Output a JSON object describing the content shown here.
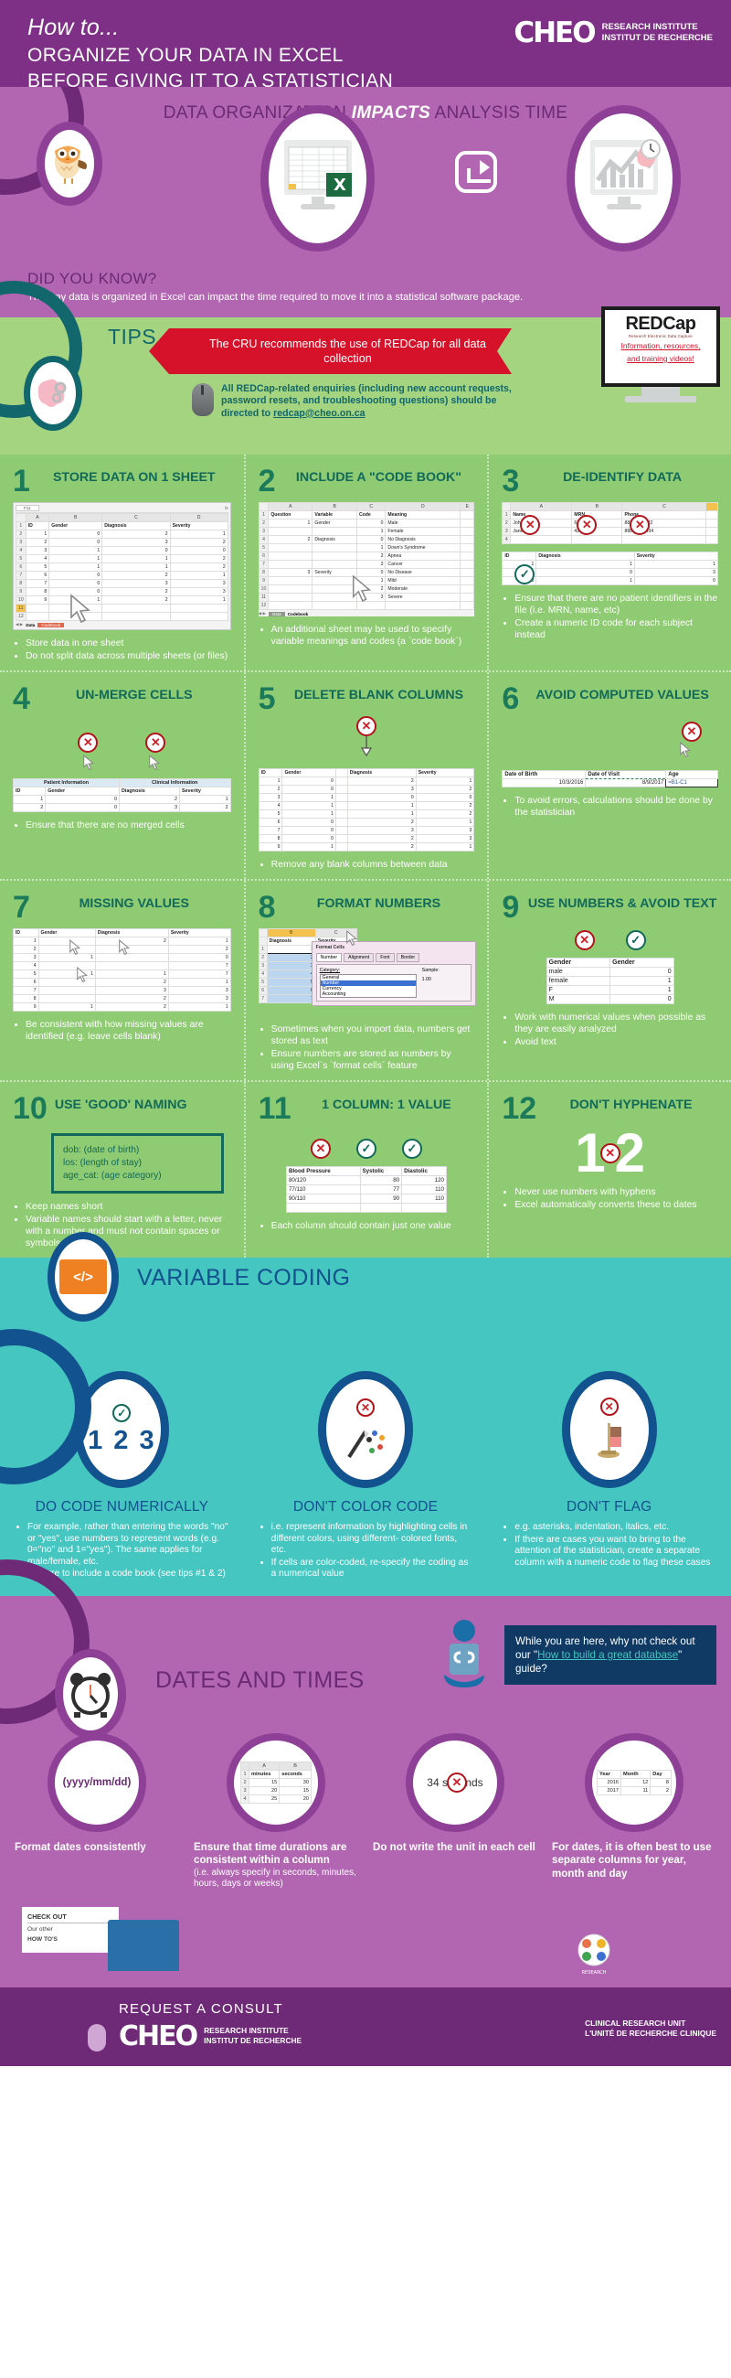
{
  "header": {
    "kicker": "How to...",
    "title_line1": "ORGANIZE YOUR DATA IN EXCEL",
    "title_line2": "BEFORE GIVING IT TO A STATISTICIAN",
    "brand": "CHEO",
    "brand_sub_en": "RESEARCH INSTITUTE",
    "brand_sub_fr": "INSTITUT DE RECHERCHE"
  },
  "impact": {
    "pre": "DATA ORGANIZATION",
    "em": "IMPACTS",
    "post": "ANALYSIS TIME"
  },
  "did_you_know": {
    "heading": "DID YOU KNOW?",
    "body": "The way data is organized in Excel can impact the time required to move it into a statistical software package."
  },
  "tips_banner": {
    "label": "TIPS",
    "ribbon": "The CRU recommends the use of REDCap for all data collection",
    "redcap_logo": "REDCap",
    "redcap_tagline": "Research Electronic Data Capture",
    "redcap_link_l1": "Information, resources,",
    "redcap_link_l2": "and training videos!",
    "note_text": "All REDCap-related enquiries (including new account requests, password resets, and troubleshooting questions) should be directed to ",
    "note_email": "redcap@cheo.on.ca"
  },
  "tips": [
    {
      "num": "1",
      "title": "STORE DATA ON 1 SHEET",
      "bullets": [
        "Store data in one sheet",
        "Do not split data across multiple sheets (or files)"
      ],
      "table": {
        "name_box": "F11",
        "col_letters": [
          "A",
          "B",
          "C",
          "D"
        ],
        "headers": [
          "ID",
          "Gender",
          "Diagnosis",
          "Severity"
        ],
        "rows": [
          [
            "1",
            "0",
            "2",
            "1"
          ],
          [
            "2",
            "0",
            "3",
            "2"
          ],
          [
            "3",
            "1",
            "0",
            "0"
          ],
          [
            "4",
            "1",
            "1",
            "2"
          ],
          [
            "5",
            "1",
            "1",
            "2"
          ],
          [
            "6",
            "0",
            "2",
            "1"
          ],
          [
            "7",
            "0",
            "3",
            "3"
          ],
          [
            "8",
            "0",
            "2",
            "3"
          ],
          [
            "9",
            "1",
            "2",
            "1"
          ]
        ],
        "sheet_tabs": [
          "Data",
          "Codebook"
        ]
      }
    },
    {
      "num": "2",
      "title": "INCLUDE A \"CODE BOOK\"",
      "bullets": [
        "An additional sheet may be used to specify variable meanings and codes (a `code book`)"
      ],
      "table": {
        "col_letters": [
          "A",
          "B",
          "C",
          "D",
          "E"
        ],
        "headers": [
          "Question",
          "Variable",
          "Code",
          "Meaning"
        ],
        "rows": [
          [
            "1",
            "Gender",
            "0",
            "Male"
          ],
          [
            "",
            "",
            "1",
            "Female"
          ],
          [
            "2",
            "Diagnosis",
            "0",
            "No Diagnosis"
          ],
          [
            "",
            "",
            "1",
            "Down's Syndrome"
          ],
          [
            "",
            "",
            "2",
            "Apnea"
          ],
          [
            "",
            "",
            "3",
            "Cancer"
          ],
          [
            "3",
            "Severity",
            "0",
            "No Disease"
          ],
          [
            "",
            "",
            "1",
            "Mild"
          ],
          [
            "",
            "",
            "2",
            "Moderate"
          ],
          [
            "",
            "",
            "3",
            "Severe"
          ]
        ],
        "sheet_tabs": [
          "Data",
          "Codebook"
        ]
      }
    },
    {
      "num": "3",
      "title": "DE-IDENTIFY DATA",
      "bullets": [
        "Ensure that there are no patient identifiers in the file (i.e. MRN, name, etc)",
        "Create a numeric ID code for each subject instead"
      ],
      "bad_table": {
        "col_letters": [
          "A",
          "B",
          "C"
        ],
        "headers": [
          "Name",
          "MRN",
          "Phone"
        ],
        "rows": [
          [
            "John Doe",
            "632542",
            "888-111-2222"
          ],
          [
            "Jane Doe",
            "424454",
            "888-333-1434"
          ]
        ]
      },
      "good_table": {
        "headers": [
          "ID",
          "Diagnosis",
          "Severity"
        ],
        "rows": [
          [
            "1",
            "1",
            "1"
          ],
          [
            "2",
            "0",
            "3"
          ],
          [
            "3",
            "1",
            "0"
          ]
        ]
      }
    },
    {
      "num": "4",
      "title": "UN-MERGE CELLS",
      "bullets": [
        "Ensure that there are no merged cells"
      ],
      "table": {
        "merged": [
          "Patient Information",
          "Clinical Information"
        ],
        "headers": [
          "ID",
          "Gender",
          "Diagnosis",
          "Severity"
        ],
        "rows": [
          [
            "1",
            "0",
            "2",
            "1"
          ],
          [
            "2",
            "0",
            "3",
            "2"
          ]
        ]
      }
    },
    {
      "num": "5",
      "title": "DELETE BLANK COLUMNS",
      "bullets": [
        "Remove any blank columns between data"
      ],
      "table": {
        "headers": [
          "ID",
          "Gender",
          "",
          "Diagnosis",
          "Severity"
        ],
        "rows": [
          [
            "1",
            "0",
            "",
            "2",
            "1"
          ],
          [
            "2",
            "0",
            "",
            "3",
            "2"
          ],
          [
            "3",
            "1",
            "",
            "0",
            "0"
          ],
          [
            "4",
            "1",
            "",
            "1",
            "2"
          ],
          [
            "5",
            "1",
            "",
            "1",
            "2"
          ],
          [
            "6",
            "0",
            "",
            "2",
            "1"
          ],
          [
            "7",
            "0",
            "",
            "3",
            "3"
          ],
          [
            "8",
            "0",
            "",
            "2",
            "3"
          ],
          [
            "9",
            "1",
            "",
            "2",
            "1"
          ]
        ]
      }
    },
    {
      "num": "6",
      "title": "AVOID COMPUTED VALUES",
      "bullets": [
        "To avoid errors, calculations should be done by the statistician"
      ],
      "table": {
        "headers": [
          "Date of Birth",
          "Date of Visit",
          "Age"
        ],
        "rows": [
          [
            "10/3/2016",
            "8/9/2017",
            "=B1-C1"
          ]
        ]
      }
    },
    {
      "num": "7",
      "title": "MISSING VALUES",
      "bullets": [
        "Be consistent with how missing values are identified (e.g. leave cells blank)"
      ],
      "table": {
        "headers": [
          "ID",
          "Gender",
          "Diagnosis",
          "Severity"
        ],
        "rows": [
          [
            "1",
            "",
            "2",
            "1"
          ],
          [
            "2",
            "",
            "",
            "2"
          ],
          [
            "3",
            "1",
            "",
            "0"
          ],
          [
            "4",
            "",
            "",
            "7"
          ],
          [
            "5",
            "1",
            "1",
            "7"
          ],
          [
            "6",
            "",
            "2",
            "1"
          ],
          [
            "7",
            "",
            "3",
            "3"
          ],
          [
            "8",
            "",
            "2",
            "3"
          ],
          [
            "9",
            "1",
            "2",
            "1"
          ]
        ]
      }
    },
    {
      "num": "8",
      "title": "FORMAT NUMBERS",
      "bullets": [
        "Sometimes when you import data, numbers get stored as text",
        "Ensure numbers are stored as numbers by using Excel`s `format cells` feature"
      ],
      "table": {
        "col_letters": [
          "B",
          "C",
          "D",
          "E"
        ],
        "headers": [
          "Diagnosis",
          "Severity"
        ],
        "rows": [
          [
            "1",
            "1"
          ],
          [
            "2",
            "0"
          ],
          [
            "3",
            "1"
          ],
          [
            "4",
            "1"
          ],
          [
            "5",
            "1"
          ],
          [
            "6",
            "0"
          ],
          [
            "7",
            "0"
          ]
        ]
      },
      "dialog": {
        "title": "Format Cells",
        "tabs": [
          "Number",
          "Alignment",
          "Font",
          "Border"
        ],
        "category_label": "Category:",
        "categories": [
          "General",
          "Number",
          "Currency",
          "Accounting"
        ],
        "selected_category": "Number",
        "sample_label": "Sample:",
        "sample_value": "1.00"
      }
    },
    {
      "num": "9",
      "title": "USE NUMBERS & AVOID TEXT",
      "bullets": [
        "Work with numerical values when possible as they are easily analyzed",
        "Avoid text"
      ],
      "table": {
        "headers": [
          "Gender",
          "Gender"
        ],
        "rows": [
          [
            "male",
            "0"
          ],
          [
            "female",
            "1"
          ],
          [
            "F",
            "1"
          ],
          [
            "M",
            "0"
          ]
        ]
      }
    },
    {
      "num": "10",
      "title": "USE 'GOOD' NAMING",
      "bullets": [
        "Keep names short",
        "Variable names should start with a letter, never with a number and must not contain spaces or symbols"
      ],
      "box_lines": [
        "dob: (date of birth)",
        "los: (length of stay)",
        "age_cat: (age category)"
      ]
    },
    {
      "num": "11",
      "title": "1 COLUMN: 1 VALUE",
      "bullets": [
        "Each column should contain just one value"
      ],
      "table": {
        "headers": [
          "Blood Pressure",
          "Systolic",
          "Diastolic"
        ],
        "rows": [
          [
            "80/120",
            "80",
            "120"
          ],
          [
            "77/110",
            "77",
            "110"
          ],
          [
            "90/110",
            "90",
            "110"
          ]
        ]
      }
    },
    {
      "num": "12",
      "title": "DON'T HYPHENATE",
      "bullets": [
        "Never use numbers with hyphens",
        "Excel automatically converts these to dates"
      ],
      "big_left": "1",
      "big_right": "2"
    }
  ],
  "variable_coding": {
    "section_title": "VARIABLE CODING",
    "columns": [
      {
        "heading": "DO CODE NUMERICALLY",
        "icon_text": "1 2 3",
        "mark": "check",
        "bullets": [
          "For example, rather than entering the words \"no\" or \"yes\", use numbers to represent words (e.g. 0=\"no\" and 1=\"yes\"). The same applies for male/female, etc.",
          "Be sure to include a code book (see tips #1 & 2)"
        ]
      },
      {
        "heading": "DON'T COLOR CODE",
        "icon_text": "",
        "mark": "cross",
        "bullets": [
          "i.e. represent information by highlighting cells in different colors, using different- colored fonts, etc.",
          "If cells are color-coded, re-specify the coding as a numerical value"
        ]
      },
      {
        "heading": "DON'T FLAG",
        "icon_text": "",
        "mark": "cross",
        "bullets": [
          "e.g. asterisks, indentation, italics, etc.",
          "If there are cases you want to bring to the attention of the statistician, create a separate column with a numeric code to flag these cases"
        ]
      }
    ]
  },
  "dates_times": {
    "section_title": "DATES AND TIMES",
    "speech_pre": "While you are here, why not check out our \"",
    "speech_link": "How to build a great database",
    "speech_post": "\" guide?",
    "columns": [
      {
        "icon_text": "(yyyy/mm/dd)",
        "caption": "Format dates consistently",
        "sub": ""
      },
      {
        "icon_table": {
          "col_letters": [
            "A",
            "B"
          ],
          "headers": [
            "minutes",
            "seconds"
          ],
          "rows": [
            [
              "15",
              "30"
            ],
            [
              "20",
              "15"
            ],
            [
              "25",
              "20"
            ]
          ]
        },
        "caption": "Ensure that time durations are consistent within a column",
        "sub": "(i.e. always specify in seconds, minutes, hours, days or weeks)"
      },
      {
        "icon_text": "34 seconds",
        "caption": "Do not write the unit in each cell",
        "sub": ""
      },
      {
        "icon_table": {
          "headers": [
            "Year",
            "Month",
            "Day"
          ],
          "rows": [
            [
              "2016",
              "12",
              "8"
            ],
            [
              "2017",
              "11",
              "2"
            ]
          ]
        },
        "caption": "For dates, it is often best to use separate columns for year, month and day",
        "sub": ""
      }
    ]
  },
  "checkout": {
    "note_heading": "CHECK OUT",
    "note_body_l1": "Our other",
    "note_body_l2": "HOW TO'S",
    "research_badge": "RESEARCH INSTITUTE"
  },
  "footer": {
    "request": "REQUEST A CONSULT",
    "brand": "CHEO",
    "brand_sub_en": "RESEARCH INSTITUTE",
    "brand_sub_fr": "INSTITUT DE RECHERCHE",
    "unit_en": "CLINICAL RESEARCH UNIT",
    "unit_fr": "L'UNITÉ DE RECHERCHE CLINIQUE"
  },
  "colors": {
    "purple_dark": "#6e2a77",
    "purple_mid": "#7e2f86",
    "purple_light": "#b266b2",
    "green_light": "#8fcb72",
    "green_band": "#a4d47f",
    "teal": "#45c6c0",
    "teal_dark": "#11676b",
    "blue": "#12528f",
    "red": "#d6122b",
    "green_dark": "#11695a"
  }
}
